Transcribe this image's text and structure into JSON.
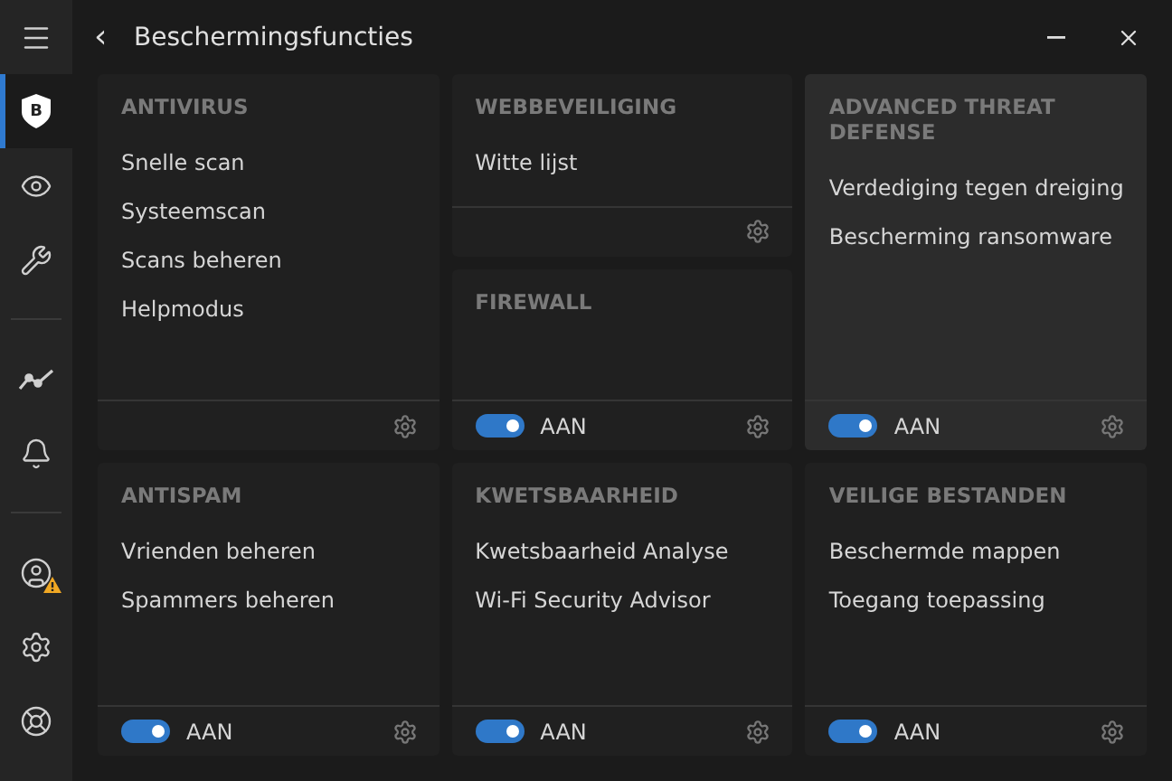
{
  "window": {
    "title": "Beschermingsfuncties",
    "back": "‹"
  },
  "sidebar": {
    "items": [
      {
        "kind": "menu",
        "selected": false
      },
      {
        "kind": "protection",
        "selected": true,
        "letter": "B"
      },
      {
        "kind": "privacy",
        "selected": false
      },
      {
        "kind": "utilities",
        "selected": false
      },
      {
        "kind": "divider"
      },
      {
        "kind": "activity",
        "selected": false
      },
      {
        "kind": "notifications",
        "selected": false
      },
      {
        "kind": "divider"
      },
      {
        "kind": "account",
        "selected": false,
        "warning": true
      },
      {
        "kind": "settings",
        "selected": false
      },
      {
        "kind": "support",
        "selected": false
      }
    ]
  },
  "top_columns": [
    [
      {
        "title": "ANTIVIRUS",
        "highlighted": false,
        "items": [
          "Snelle scan",
          "Systeemscan",
          "Scans beheren",
          "Helpmodus"
        ]
      }
    ],
    [
      {
        "title": "WEBBEVEILIGING",
        "highlighted": false,
        "items": [
          "Witte lijst"
        ]
      },
      {
        "title": "FIREWALL",
        "highlighted": false,
        "toggle": {
          "on": true,
          "label": "AAN"
        }
      }
    ],
    [
      {
        "title": "ADVANCED THREAT DEFENSE",
        "highlighted": true,
        "items": [
          "Verdediging tegen dreiging",
          "Bescherming ransomware"
        ],
        "toggle": {
          "on": true,
          "label": "AAN"
        }
      }
    ]
  ],
  "bottom_cards": [
    {
      "title": "ANTISPAM",
      "highlighted": false,
      "items": [
        "Vrienden beheren",
        "Spammers beheren"
      ],
      "toggle": {
        "on": true,
        "label": "AAN"
      }
    },
    {
      "title": "KWETSBAARHEID",
      "highlighted": false,
      "items": [
        "Kwetsbaarheid Analyse",
        "Wi-Fi Security Advisor"
      ],
      "toggle": {
        "on": true,
        "label": "AAN"
      }
    },
    {
      "title": "VEILIGE BESTANDEN",
      "highlighted": false,
      "items": [
        "Beschermde mappen",
        "Toegang toepassing"
      ],
      "toggle": {
        "on": true,
        "label": "AAN"
      }
    }
  ]
}
